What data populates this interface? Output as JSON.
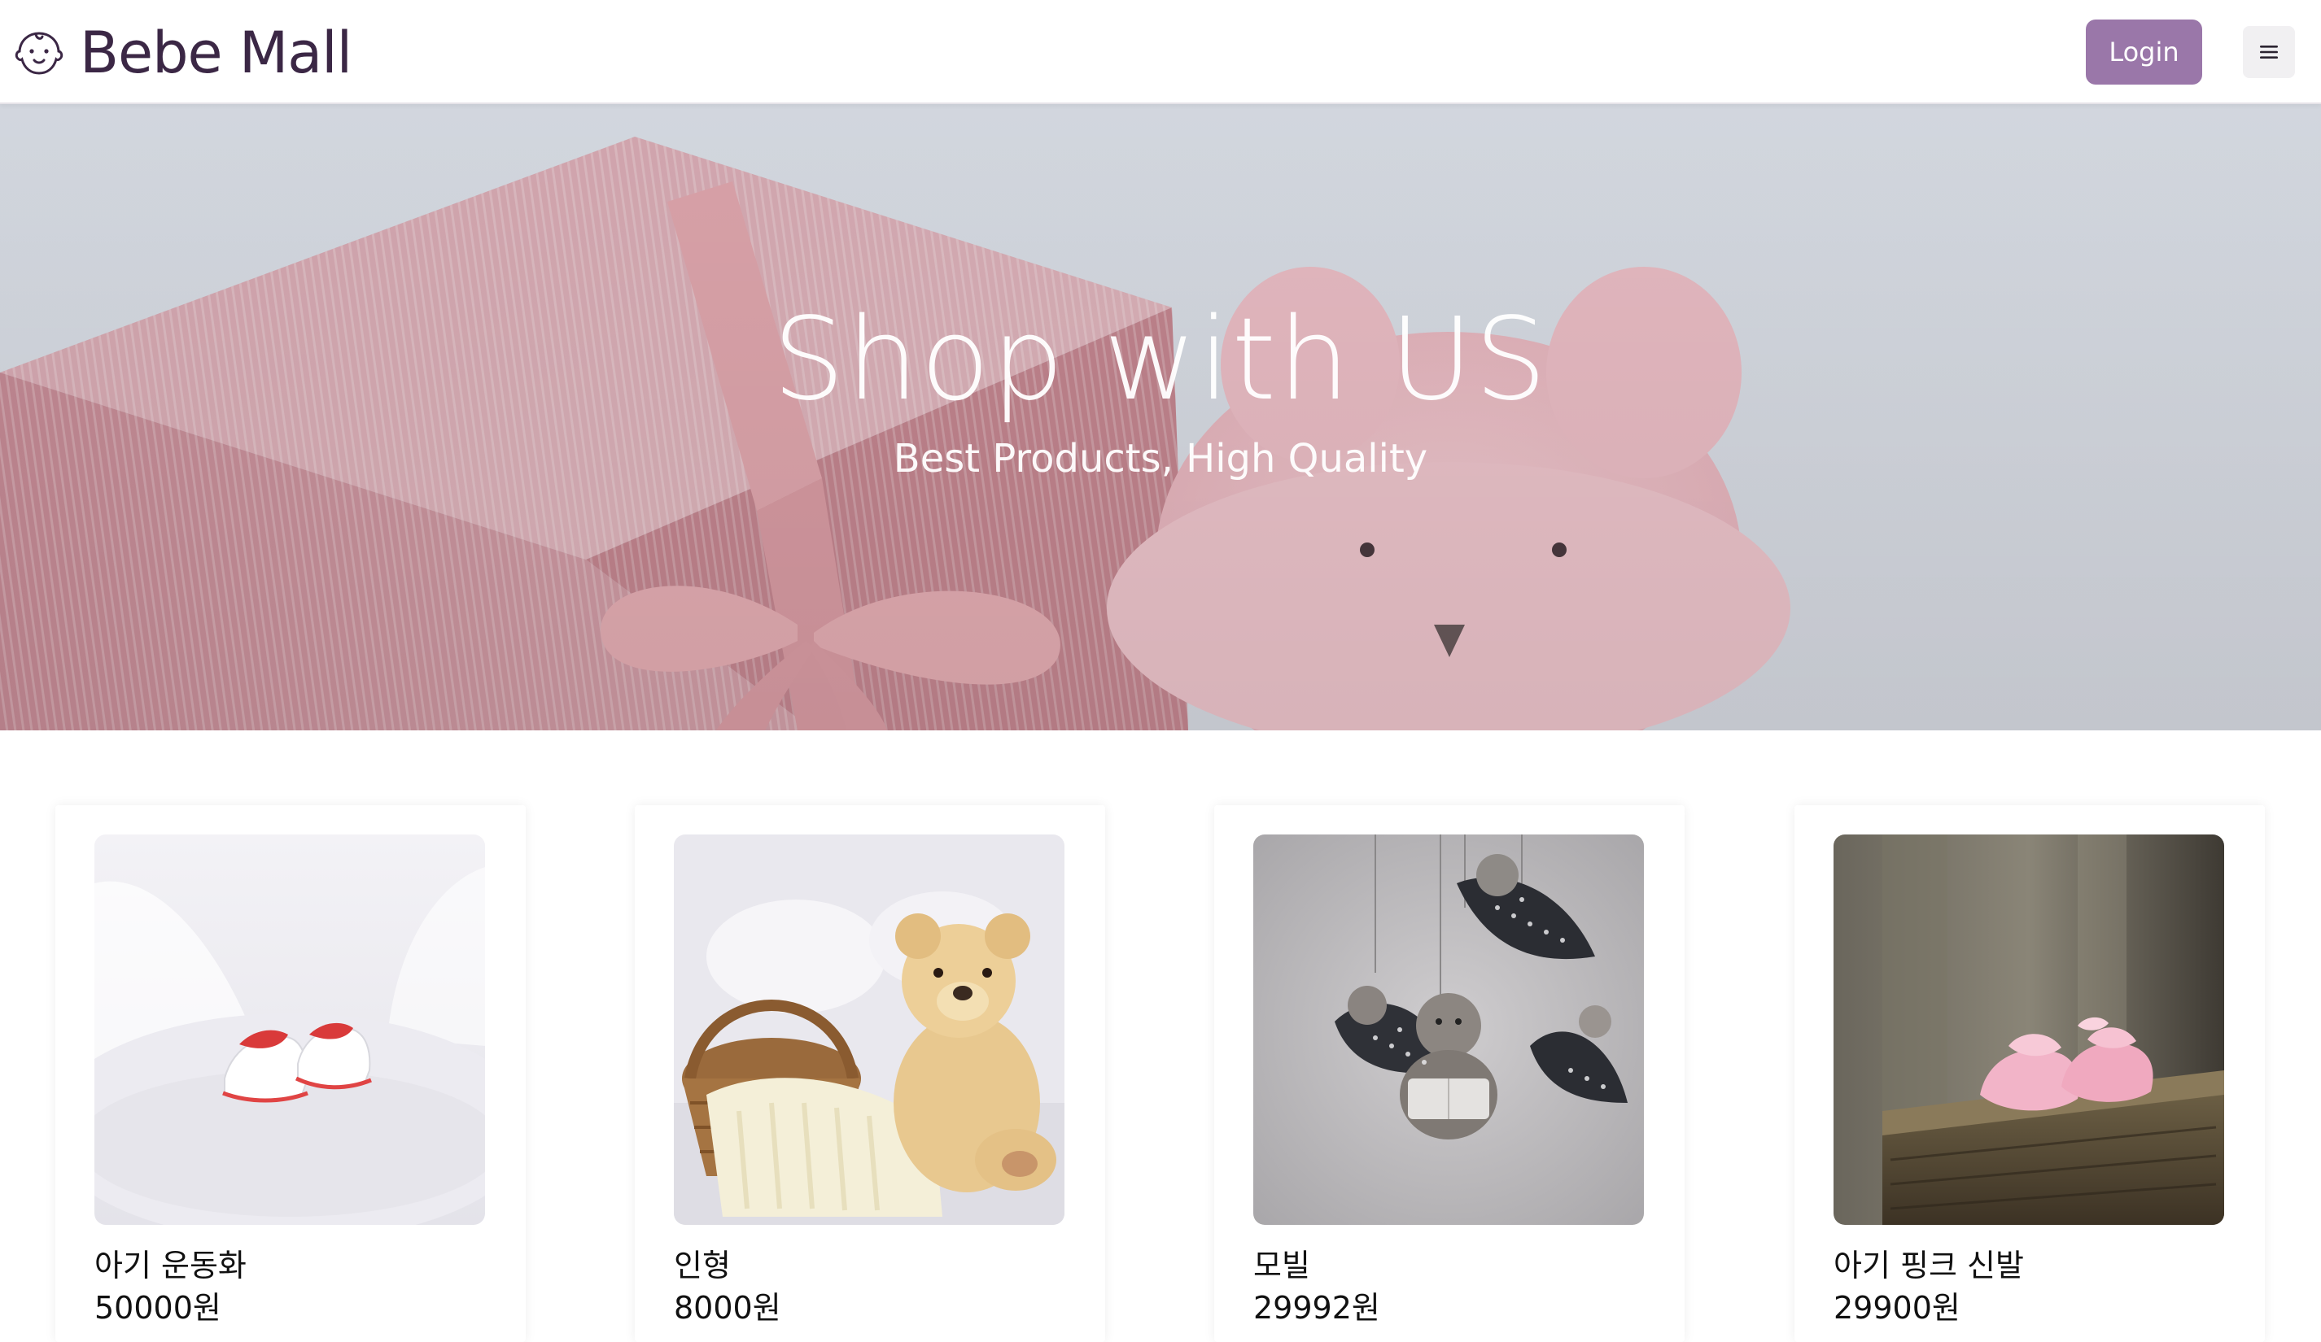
{
  "header": {
    "brand_name": "Bebe Mall",
    "logo_icon": "baby-face-icon",
    "login_label": "Login",
    "menu_icon": "hamburger-menu-icon"
  },
  "hero": {
    "title": "Shop with US",
    "subtitle": "Best Products, High Quality"
  },
  "products": [
    {
      "name": "아기 운동화",
      "price": "50000원",
      "image": "baby-sneakers-image"
    },
    {
      "name": "인형",
      "price": "8000원",
      "image": "teddy-bear-image"
    },
    {
      "name": "모빌",
      "price": "29992원",
      "image": "baby-mobile-image"
    },
    {
      "name": "아기 핑크 신발",
      "price": "29900원",
      "image": "pink-baby-shoes-image"
    }
  ],
  "colors": {
    "brand_text": "#3b2745",
    "login_button": "#9a77a9",
    "hero_tint": "#d9b3bd"
  }
}
